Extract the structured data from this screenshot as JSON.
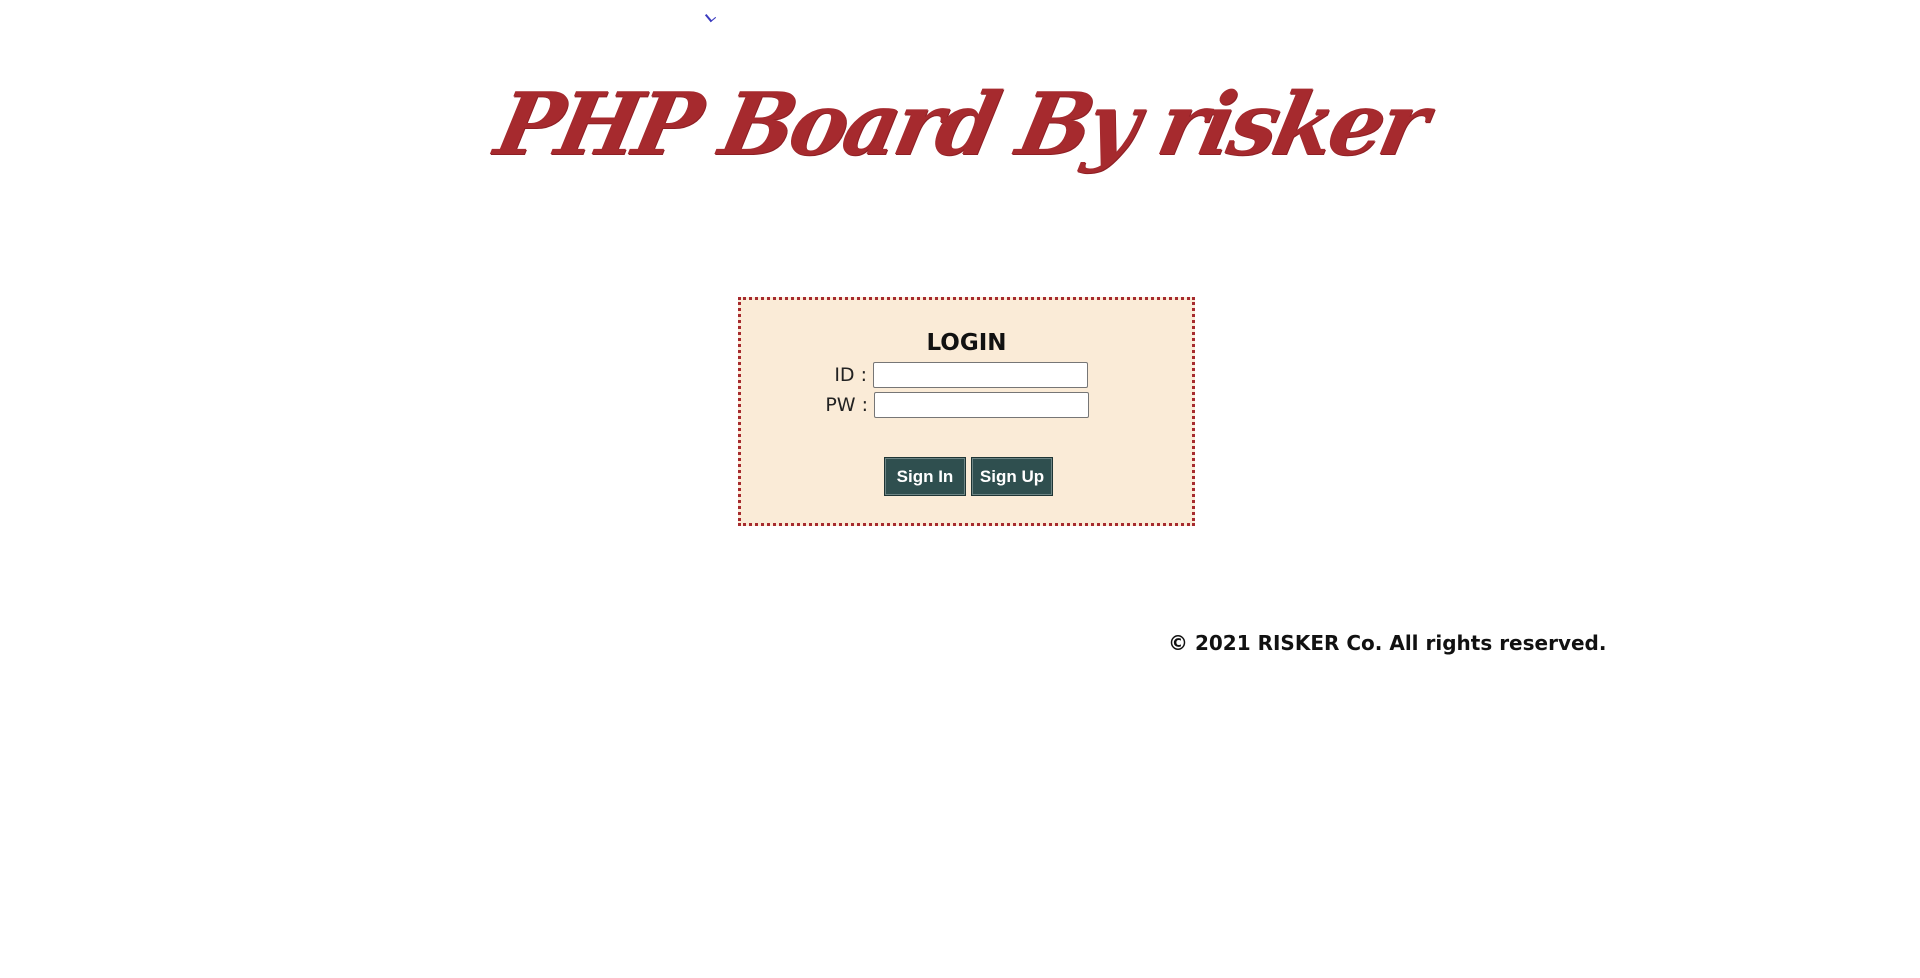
{
  "header": {
    "title": "PHP Board By risker"
  },
  "login": {
    "heading": "LOGIN",
    "id_label": "ID :",
    "id_value": "",
    "pw_label": "PW :",
    "pw_value": "",
    "signin_label": "Sign In",
    "signup_label": "Sign Up"
  },
  "footer": {
    "copyright": "© 2021 RISKER Co. All rights reserved."
  },
  "colors": {
    "title": "#a62a2e",
    "box_background": "#faebd7",
    "box_border": "#a62a2e",
    "button_background": "#2f4f4f",
    "button_text": "#ffffff"
  }
}
